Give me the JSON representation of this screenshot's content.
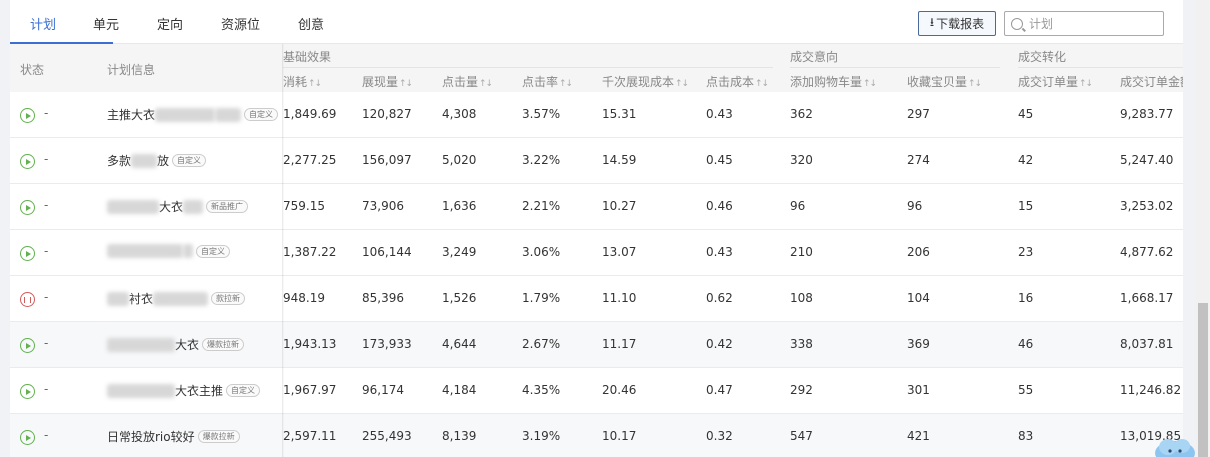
{
  "tabs": [
    "计划",
    "单元",
    "定向",
    "资源位",
    "创意"
  ],
  "download_label": "下载报表",
  "search_placeholder": "计划",
  "header": {
    "status": "状态",
    "plan_info": "计划信息",
    "group_basic": "基础效果",
    "group_intent": "成交意向",
    "group_conversion": "成交转化",
    "cols": [
      "消耗",
      "展现量",
      "点击量",
      "点击率",
      "千次展现成本",
      "点击成本",
      "添加购物车量",
      "收藏宝贝量",
      "成交订单量",
      "成交订单金额"
    ],
    "sort_glyph": "↑↓"
  },
  "rows": [
    {
      "status": "running",
      "name_pre": "主推大衣",
      "name_post": "",
      "tag": "自定义",
      "values": [
        "1,849.69",
        "120,827",
        "4,308",
        "3.57%",
        "15.31",
        "0.43",
        "362",
        "297",
        "45",
        "9,283.77"
      ]
    },
    {
      "status": "running",
      "name_pre": "多款",
      "name_post": "放",
      "tag": "自定义",
      "values": [
        "2,277.25",
        "156,097",
        "5,020",
        "3.22%",
        "14.59",
        "0.45",
        "320",
        "274",
        "42",
        "5,247.40"
      ]
    },
    {
      "status": "running",
      "name_pre": "",
      "name_post": "大衣",
      "tag": "新品推广",
      "values": [
        "759.15",
        "73,906",
        "1,636",
        "2.21%",
        "10.27",
        "0.46",
        "96",
        "96",
        "15",
        "3,253.02"
      ]
    },
    {
      "status": "running",
      "name_pre": "",
      "name_post": "",
      "tag": "自定义",
      "values": [
        "1,387.22",
        "106,144",
        "3,249",
        "3.06%",
        "13.07",
        "0.43",
        "210",
        "206",
        "23",
        "4,877.62"
      ]
    },
    {
      "status": "paused",
      "name_pre": "",
      "name_post": "衬衣",
      "tag": "款拉新",
      "values": [
        "948.19",
        "85,396",
        "1,526",
        "1.79%",
        "11.10",
        "0.62",
        "108",
        "104",
        "16",
        "1,668.17"
      ]
    },
    {
      "status": "running",
      "name_pre": "",
      "name_post": "大衣",
      "tag": "爆款拉新",
      "values": [
        "1,943.13",
        "173,933",
        "4,644",
        "2.67%",
        "11.17",
        "0.42",
        "338",
        "369",
        "46",
        "8,037.81"
      ]
    },
    {
      "status": "running",
      "name_pre": "",
      "name_post": "大衣主推",
      "tag": "自定义",
      "values": [
        "1,967.97",
        "96,174",
        "4,184",
        "4.35%",
        "20.46",
        "0.47",
        "292",
        "301",
        "55",
        "11,246.82"
      ]
    },
    {
      "status": "running",
      "name_pre": "日常投放rio较好",
      "name_post": "",
      "tag": "爆款拉新",
      "values": [
        "2,597.11",
        "255,493",
        "8,139",
        "3.19%",
        "10.17",
        "0.32",
        "547",
        "421",
        "83",
        "13,019.85"
      ]
    }
  ],
  "row_dash": "-",
  "colors": {
    "accent": "#3b6fd4",
    "running": "#62b14f",
    "paused": "#d25b5b"
  }
}
